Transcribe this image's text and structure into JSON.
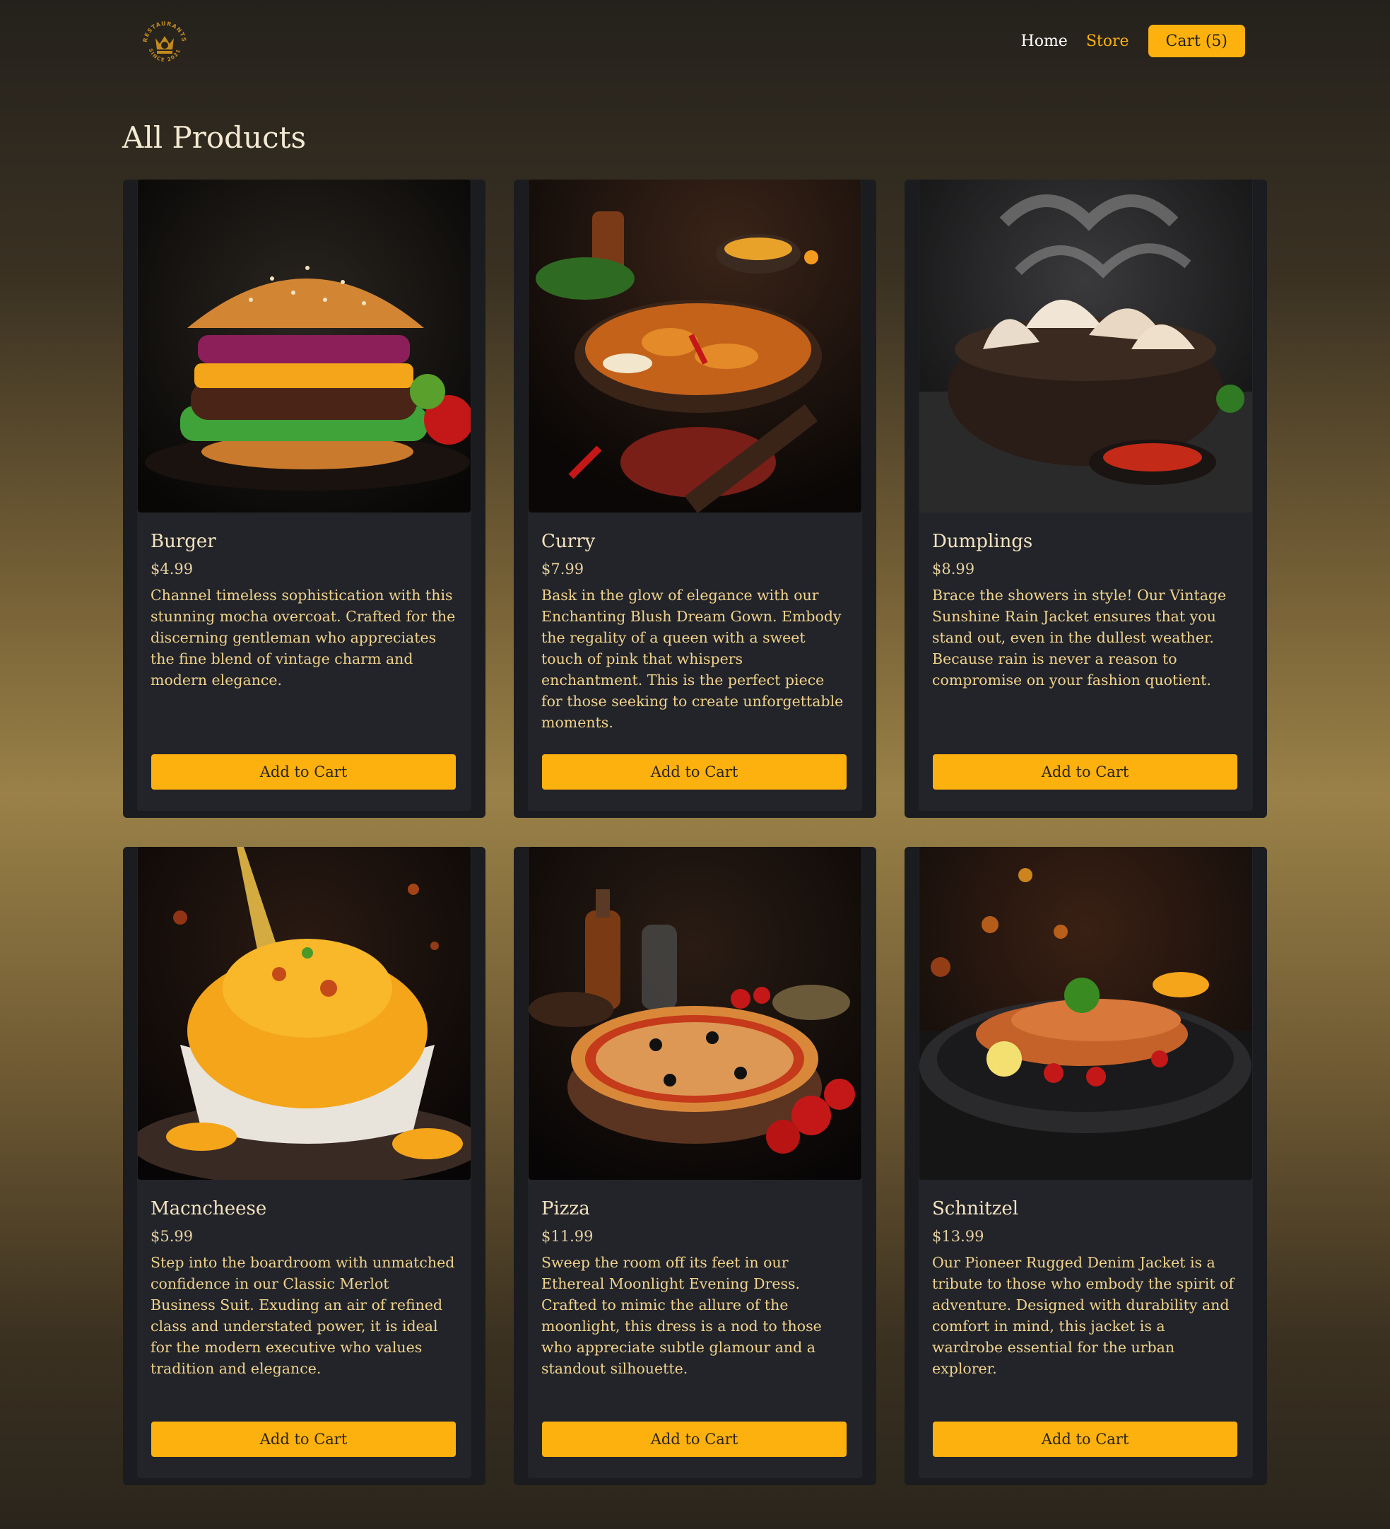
{
  "nav": {
    "logo_text": "RESTAURANTS SINCE 2021",
    "home": "Home",
    "store": "Store",
    "cart": "Cart (5)"
  },
  "page": {
    "title": "All Products"
  },
  "colors": {
    "accent": "#fdb10f",
    "card_bg": "#22242a",
    "card_frame": "#1b1c1f"
  },
  "products": [
    {
      "name": "Burger",
      "price": "$4.99",
      "description": "Channel timeless sophistication with this stunning mocha overcoat. Crafted for the discerning gentleman who appreciates the fine blend of vintage charm and modern elegance.",
      "button": "Add to Cart",
      "image": "burger-photo"
    },
    {
      "name": "Curry",
      "price": "$7.99",
      "description": "Bask in the glow of elegance with our Enchanting Blush Dream Gown. Embody the regality of a queen with a sweet touch of pink that whispers enchantment. This is the perfect piece for those seeking to create unforgettable moments.",
      "button": "Add to Cart",
      "image": "curry-photo"
    },
    {
      "name": "Dumplings",
      "price": "$8.99",
      "description": "Brace the showers in style! Our Vintage Sunshine Rain Jacket ensures that you stand out, even in the dullest weather. Because rain is never a reason to compromise on your fashion quotient.",
      "button": "Add to Cart",
      "image": "dumplings-photo"
    },
    {
      "name": "Macncheese",
      "price": "$5.99",
      "description": "Step into the boardroom with unmatched confidence in our Classic Merlot Business Suit. Exuding an air of refined class and understated power, it is ideal for the modern executive who values tradition and elegance.",
      "button": "Add to Cart",
      "image": "macncheese-photo"
    },
    {
      "name": "Pizza",
      "price": "$11.99",
      "description": "Sweep the room off its feet in our Ethereal Moonlight Evening Dress. Crafted to mimic the allure of the moonlight, this dress is a nod to those who appreciate subtle glamour and a standout silhouette.",
      "button": "Add to Cart",
      "image": "pizza-photo"
    },
    {
      "name": "Schnitzel",
      "price": "$13.99",
      "description": "Our Pioneer Rugged Denim Jacket is a tribute to those who embody the spirit of adventure. Designed with durability and comfort in mind, this jacket is a wardrobe essential for the urban explorer.",
      "button": "Add to Cart",
      "image": "schnitzel-photo"
    }
  ]
}
